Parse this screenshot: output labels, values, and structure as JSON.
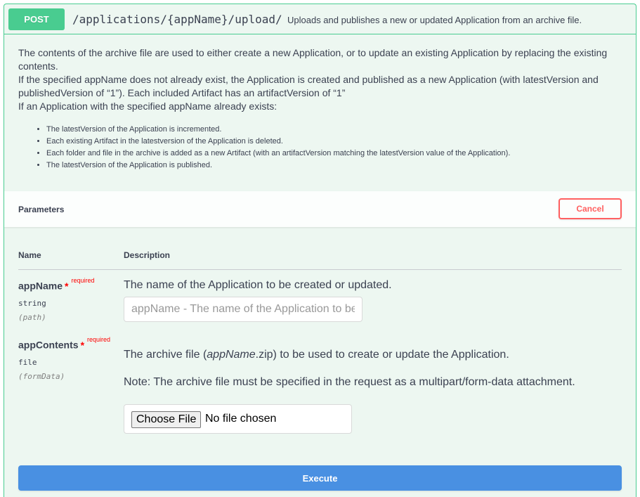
{
  "operation": {
    "method": "POST",
    "path": "/applications/{appName}/upload/",
    "summary": "Uploads and publishes a new or updated Application from an archive file."
  },
  "description": {
    "line1": "The contents of the archive file are used to either create a new Application, or to update an existing Application by replacing the existing contents.",
    "line2": "If the specified appName does not already exist, the Application is created and published as a new Application (with latestVersion and publishedVersion of “1”). Each included Artifact has an artifactVersion of “1”",
    "line3": "If an Application with the specified appName already exists:",
    "bullets": [
      "The latestVersion of the Application is incremented.",
      "Each existing Artifact in the latestversion of the Application is deleted.",
      "Each folder and file in the archive is added as a new Artifact (with an artifactVersion matching the latestVersion value of the Application).",
      "The latestVersion of the Application is published."
    ]
  },
  "parameters_section": {
    "title": "Parameters",
    "cancel_label": "Cancel",
    "col_name": "Name",
    "col_description": "Description"
  },
  "params": [
    {
      "name": "appName",
      "star": "*",
      "required": "required",
      "type": "string",
      "in": "(path)",
      "description": "The name of the Application to be created or updated.",
      "placeholder": "appName - The name of the Application to be created or updated."
    },
    {
      "name": "appContents",
      "star": "*",
      "required": "required",
      "type": "file",
      "in": "(formData)",
      "description_pre": "The archive file (",
      "description_em": "appName",
      "description_post": ".zip) to be used to create or update the Application.",
      "note": "Note: The archive file must be specified in the request as a multipart/form-data attachment.",
      "choose_file_label": "Choose File",
      "file_status": "No file chosen"
    }
  ],
  "execute_label": "Execute",
  "colors": {
    "post_green": "#49cc90",
    "post_bg": "#edf7f1",
    "cancel_red": "#ff6060",
    "execute_blue": "#4990e2",
    "required_red": "#ff0000"
  }
}
